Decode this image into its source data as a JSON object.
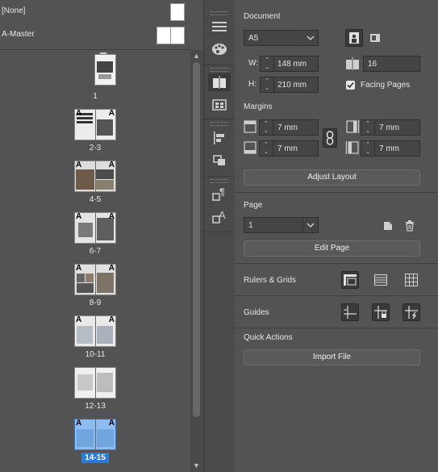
{
  "pages_panel": {
    "none_label": "[None]",
    "master_label": "A-Master",
    "spreads": [
      {
        "label": "1"
      },
      {
        "label": "2-3"
      },
      {
        "label": "4-5"
      },
      {
        "label": "6-7"
      },
      {
        "label": "8-9"
      },
      {
        "label": "10-11"
      },
      {
        "label": "12-13"
      },
      {
        "label": "14-15"
      }
    ],
    "master_prefix": "A",
    "selected_spread": "14-15"
  },
  "properties": {
    "document_title": "Document",
    "page_size": "A5",
    "width_label": "W:",
    "width_value": "148 mm",
    "height_label": "H:",
    "height_value": "210 mm",
    "pages_count": "16",
    "facing_pages_label": "Facing Pages",
    "facing_pages_checked": true,
    "margins_title": "Margins",
    "margin_top": "7 mm",
    "margin_bottom": "7 mm",
    "margin_inside": "7 mm",
    "margin_outside": "7 mm",
    "adjust_layout_label": "Adjust Layout",
    "page_title": "Page",
    "page_value": "1",
    "edit_page_label": "Edit Page",
    "rulers_grids_title": "Rulers & Grids",
    "guides_title": "Guides",
    "quick_actions_title": "Quick Actions",
    "import_file_label": "Import File"
  },
  "colors": {
    "panel_bg": "#535353",
    "selection": "#2d7bd6"
  }
}
